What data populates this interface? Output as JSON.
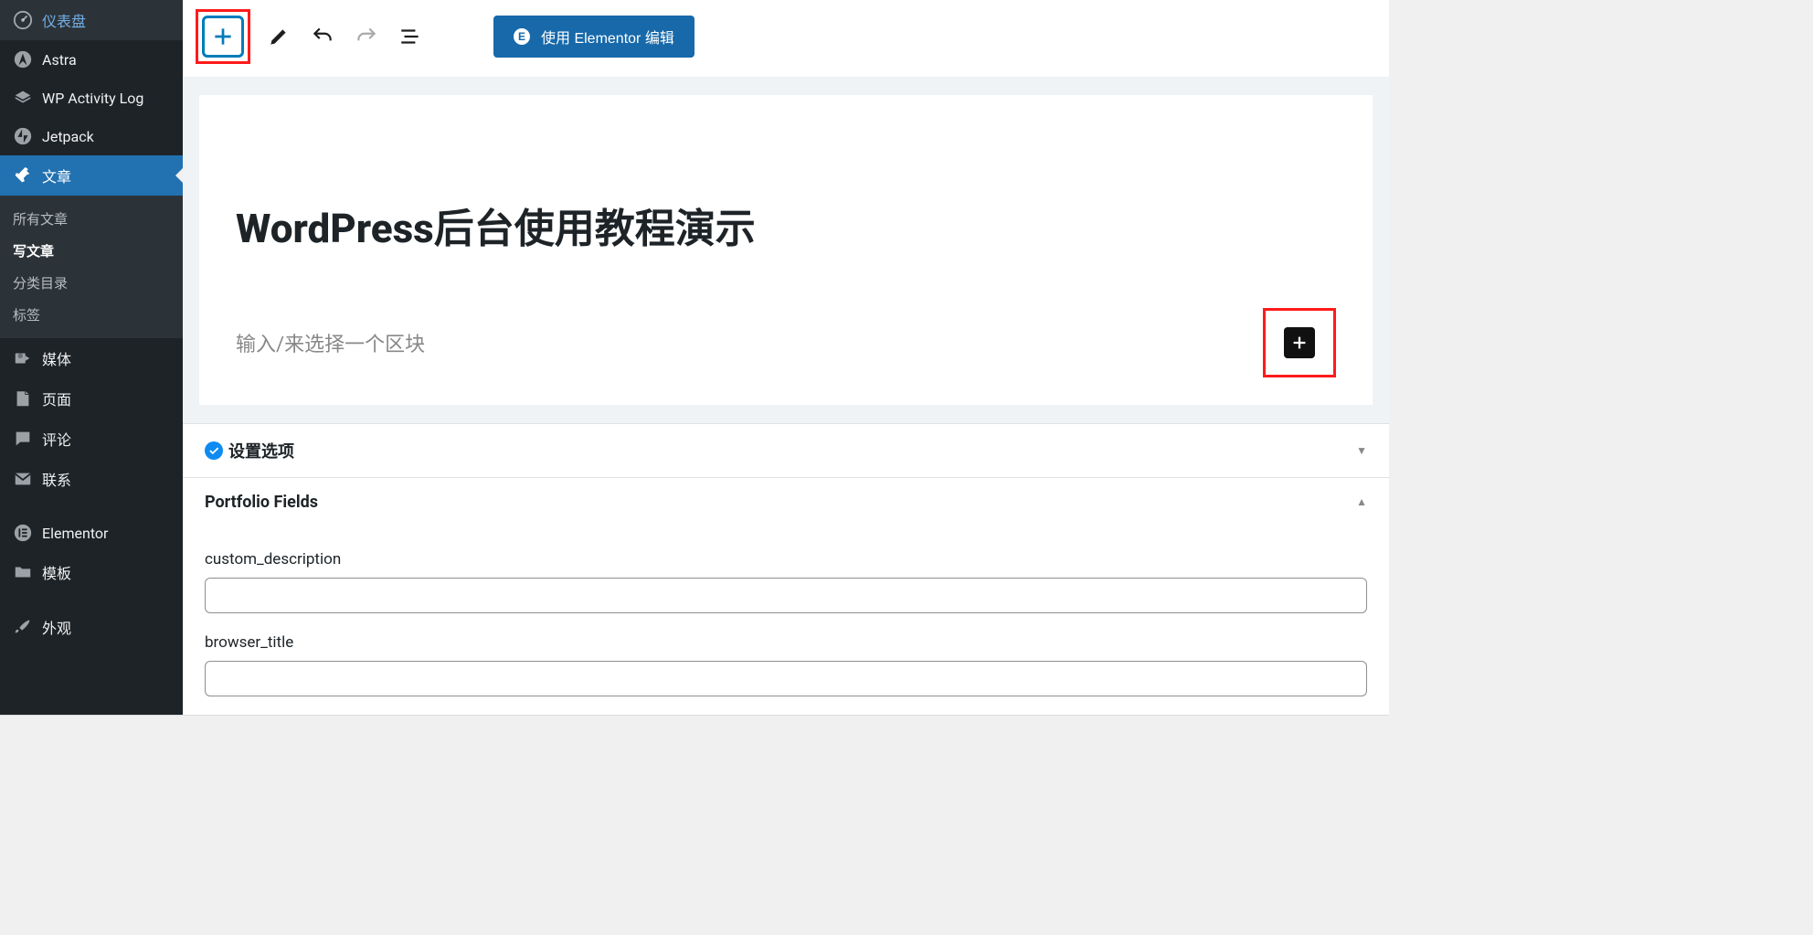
{
  "sidebar": {
    "items": [
      {
        "label": "仪表盘",
        "icon": "dashboard-icon"
      },
      {
        "label": "Astra",
        "icon": "astra-icon"
      },
      {
        "label": "WP Activity Log",
        "icon": "eye-icon"
      },
      {
        "label": "Jetpack",
        "icon": "jetpack-icon"
      },
      {
        "label": "文章",
        "icon": "pin-icon",
        "active": true
      },
      {
        "label": "媒体",
        "icon": "media-icon"
      },
      {
        "label": "页面",
        "icon": "page-icon"
      },
      {
        "label": "评论",
        "icon": "comment-icon"
      },
      {
        "label": "联系",
        "icon": "mail-icon"
      },
      {
        "label": "Elementor",
        "icon": "elementor-icon"
      },
      {
        "label": "模板",
        "icon": "folder-icon"
      },
      {
        "label": "外观",
        "icon": "brush-icon"
      }
    ],
    "sub": [
      {
        "label": "所有文章"
      },
      {
        "label": "写文章",
        "active": true
      },
      {
        "label": "分类目录"
      },
      {
        "label": "标签"
      }
    ]
  },
  "toolbar": {
    "elementor_label": "使用 Elementor 编辑",
    "elementor_icon_letter": "E"
  },
  "editor": {
    "title": "WordPress后台使用教程演示",
    "block_placeholder": "输入/来选择一个区块"
  },
  "panels": {
    "settings_title": "设置选项",
    "portfolio_title": "Portfolio Fields",
    "fields": [
      {
        "label": "custom_description",
        "value": ""
      },
      {
        "label": "browser_title",
        "value": ""
      }
    ]
  }
}
